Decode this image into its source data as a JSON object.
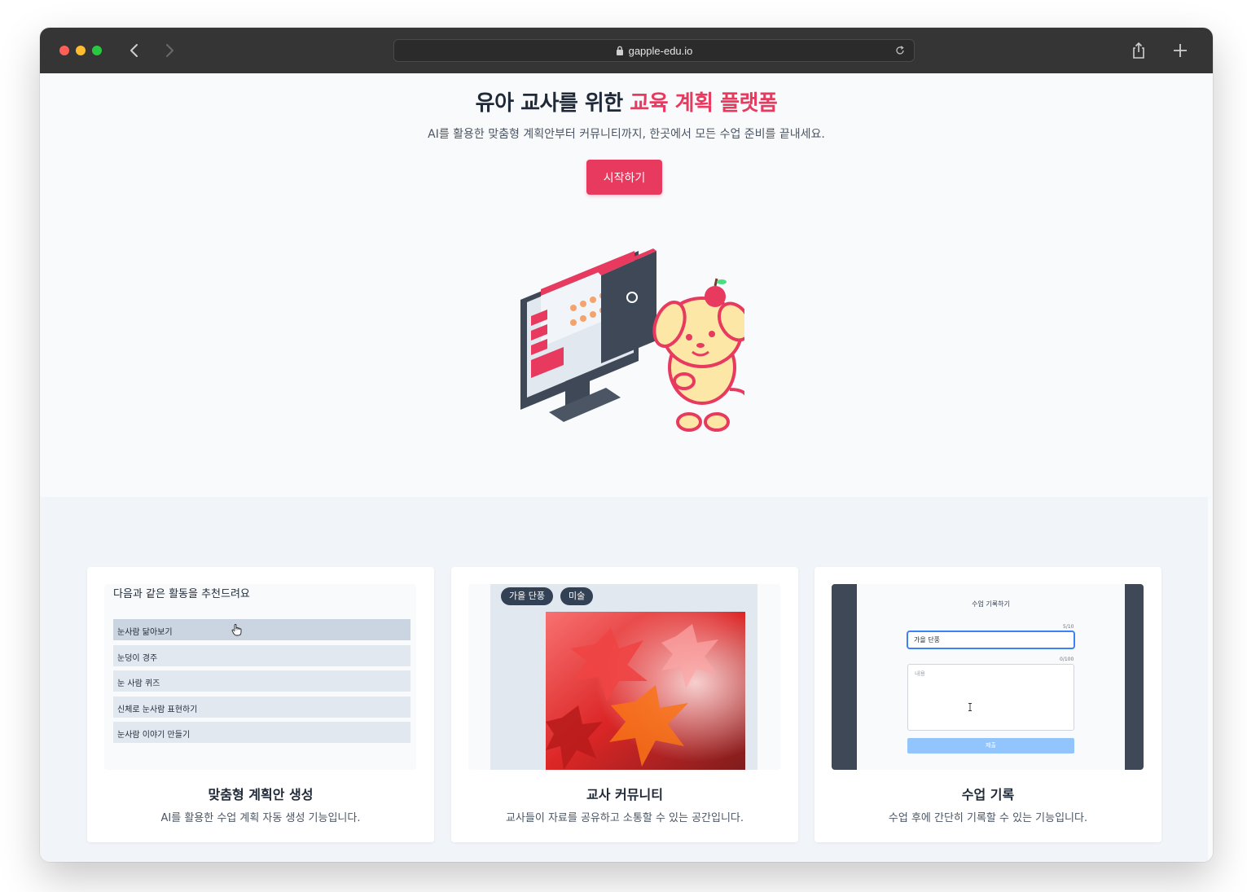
{
  "browser": {
    "url": "gapple-edu.io"
  },
  "hero": {
    "title_prefix": "유아 교사를 위한 ",
    "title_accent": "교육 계획 플랫폼",
    "subtitle": "AI를 활용한 맞춤형 계획안부터 커뮤니티까지, 한곳에서 모든 수업 준비를 끝내세요.",
    "cta_label": "시작하기",
    "accent_color": "#e8395f"
  },
  "features": [
    {
      "title": "맞춤형 계획안 생성",
      "description": "AI를 활용한 수업 계획 자동 생성 기능입니다.",
      "preview": {
        "heading": "다음과 같은 활동을 추천드려요",
        "items": [
          "눈사람 닮아보기",
          "눈덩이 경주",
          "눈 사람 퀴즈",
          "신체로 눈사람 표현하기",
          "눈사람 이야기 만들기"
        ]
      }
    },
    {
      "title": "교사 커뮤니티",
      "description": "교사들이 자료를 공유하고 소통할 수 있는 공간입니다.",
      "preview": {
        "tags": [
          "가을 단풍",
          "미술"
        ]
      }
    },
    {
      "title": "수업 기록",
      "description": "수업 후에 간단히 기록할 수 있는 기능입니다.",
      "preview": {
        "modal_title": "수업 기록하기",
        "title_counter": "5/10",
        "title_value": "가을 단풍",
        "content_counter": "0/100",
        "content_placeholder": "내용",
        "submit_label": "제출"
      }
    }
  ]
}
